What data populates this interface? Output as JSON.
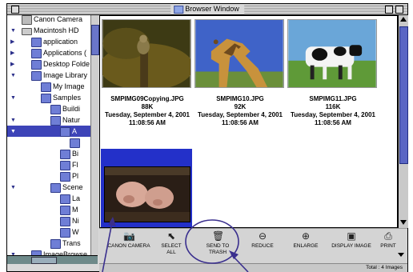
{
  "window": {
    "title": "Browser Window"
  },
  "sidebar": {
    "items": [
      {
        "label": "Canon Camera",
        "indent": 0,
        "expanded": null,
        "icon": "camera-icon"
      },
      {
        "label": "Macintosh HD",
        "indent": 0,
        "expanded": true,
        "icon": "hard-disk-icon"
      },
      {
        "label": "application",
        "indent": 1,
        "expanded": false,
        "icon": "folder-icon"
      },
      {
        "label": "Applications (",
        "indent": 1,
        "expanded": false,
        "icon": "folder-icon"
      },
      {
        "label": "Desktop Folde",
        "indent": 1,
        "expanded": false,
        "icon": "folder-icon"
      },
      {
        "label": "Image Library",
        "indent": 1,
        "expanded": true,
        "icon": "folder-icon"
      },
      {
        "label": "My Image",
        "indent": 2,
        "expanded": null,
        "icon": "folder-icon"
      },
      {
        "label": "Samples",
        "indent": 2,
        "expanded": true,
        "icon": "folder-icon"
      },
      {
        "label": "Buildi",
        "indent": 3,
        "expanded": null,
        "icon": "folder-icon"
      },
      {
        "label": "Natur",
        "indent": 3,
        "expanded": true,
        "icon": "folder-icon"
      },
      {
        "label": "A",
        "indent": 4,
        "expanded": true,
        "icon": "folder-icon",
        "selected": true
      },
      {
        "label": "",
        "indent": 5,
        "expanded": null,
        "icon": "folder-icon"
      },
      {
        "label": "Bi",
        "indent": 4,
        "expanded": null,
        "icon": "folder-icon"
      },
      {
        "label": "Fl",
        "indent": 4,
        "expanded": null,
        "icon": "folder-icon"
      },
      {
        "label": "Pl",
        "indent": 4,
        "expanded": null,
        "icon": "folder-icon"
      },
      {
        "label": "Scene",
        "indent": 3,
        "expanded": true,
        "icon": "folder-icon"
      },
      {
        "label": "La",
        "indent": 4,
        "expanded": null,
        "icon": "folder-icon"
      },
      {
        "label": "M",
        "indent": 4,
        "expanded": null,
        "icon": "folder-icon"
      },
      {
        "label": "Ni",
        "indent": 4,
        "expanded": null,
        "icon": "folder-icon"
      },
      {
        "label": "W",
        "indent": 4,
        "expanded": null,
        "icon": "folder-icon"
      },
      {
        "label": "Trans",
        "indent": 3,
        "expanded": null,
        "icon": "folder-icon"
      },
      {
        "label": "ImageBrowse",
        "indent": 1,
        "expanded": true,
        "icon": "folder-icon"
      }
    ]
  },
  "thumbnails": [
    {
      "name": "SMPIMG09Copying.JPG",
      "size": "88K",
      "date": "Tuesday, September 4, 2001",
      "time": "11:08:56 AM"
    },
    {
      "name": "SMPIMG10.JPG",
      "size": "92K",
      "date": "Tuesday, September 4, 2001",
      "time": "11:08:56 AM"
    },
    {
      "name": "SMPIMG11.JPG",
      "size": "116K",
      "date": "Tuesday, September 4, 2001",
      "time": "11:08:56 AM"
    }
  ],
  "toolbar": {
    "canon_camera": "CANON CAMERA",
    "select_all_1": "SELECT",
    "select_all_2": "ALL",
    "send_to_trash_1": "SEND TO",
    "send_to_trash_2": "TRASH",
    "reduce": "REDUCE",
    "enlarge": "ENLARGE",
    "display_image": "DISPLAY IMAGE",
    "print": "PRINT"
  },
  "status": {
    "total": "Total : 4 Images"
  },
  "colors": {
    "selection": "#2330c9",
    "annotation": "#3a2f8e"
  }
}
